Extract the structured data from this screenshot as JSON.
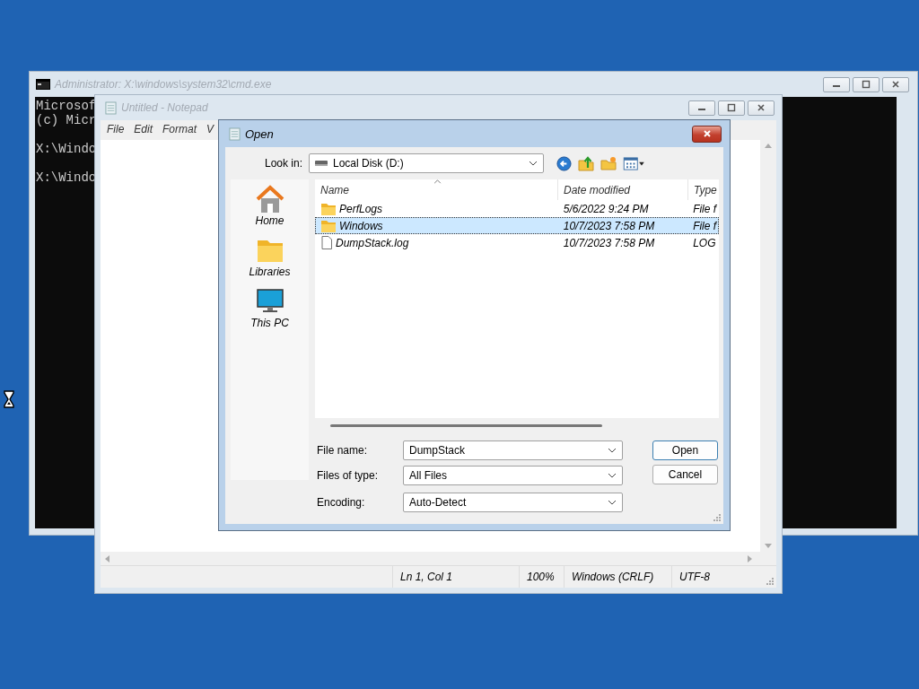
{
  "cmd_window": {
    "title": "Administrator: X:\\windows\\system32\\cmd.exe",
    "paragraphs": [
      [
        "Microsof",
        "(c) Micr"
      ],
      [
        "X:\\Windo"
      ],
      [
        "X:\\Windo"
      ]
    ]
  },
  "notepad": {
    "title": "Untitled - Notepad",
    "menu": [
      "File",
      "Edit",
      "Format",
      "V"
    ],
    "status_bar": [
      "Ln 1, Col 1",
      "100%",
      "Windows (CRLF)",
      "UTF-8"
    ]
  },
  "open_dialog": {
    "title": "Open",
    "look_in": {
      "label": "Look in:",
      "value": "Local Disk (D:)"
    },
    "places": [
      {
        "label": "Home",
        "kind": "home"
      },
      {
        "label": "Libraries",
        "kind": "libraries"
      },
      {
        "label": "This PC",
        "kind": "pc"
      }
    ],
    "columns": [
      "Name",
      "Date modified",
      "Type"
    ],
    "rows": [
      {
        "name": "PerfLogs",
        "kind": "folder",
        "date": "5/6/2022 9:24 PM",
        "type": "File f",
        "selected": false
      },
      {
        "name": "Windows",
        "kind": "folder",
        "date": "10/7/2023 7:58 PM",
        "type": "File f",
        "selected": true
      },
      {
        "name": "DumpStack.log",
        "kind": "file",
        "date": "10/7/2023 7:58 PM",
        "type": "LOG",
        "selected": false
      }
    ],
    "fields": [
      {
        "label": "File name:",
        "value": "DumpStack"
      },
      {
        "label": "Files of type:",
        "value": "All Files"
      },
      {
        "label": "Encoding:",
        "value": "Auto-Detect"
      }
    ],
    "buttons": [
      "Open",
      "Cancel"
    ]
  }
}
